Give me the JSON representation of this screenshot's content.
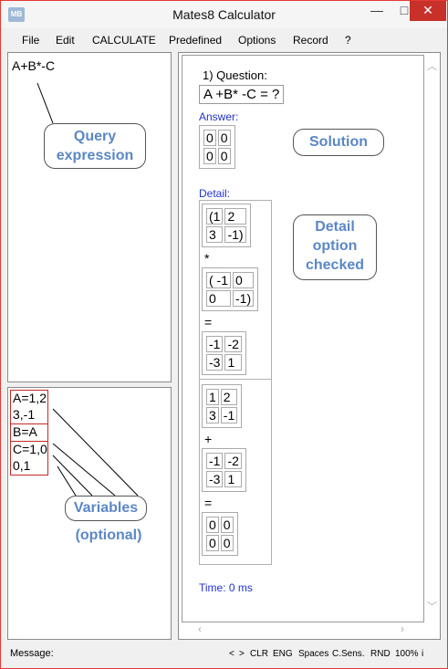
{
  "window": {
    "title": "Mates8 Calculator",
    "icon_text": "MB",
    "minimize": "—",
    "maximize": "□",
    "close": "✕"
  },
  "menu": [
    "File",
    "Edit",
    "CALCULATE",
    "Predefined",
    "Options",
    "Record",
    "?"
  ],
  "query": {
    "text": "A+B*-C"
  },
  "variables": {
    "lines": [
      "A=1,2",
      "3,-1",
      "B=A",
      "C=1,0",
      "0,1"
    ]
  },
  "callouts": {
    "query": [
      "Query",
      "expression"
    ],
    "variables": [
      "Variables",
      "(optional)"
    ],
    "solution": "Solution",
    "detail": [
      "Detail",
      "option",
      "checked"
    ]
  },
  "result": {
    "question_label": "1) Question:",
    "question": "A +B* -C = ?",
    "answer_label": "Answer:",
    "answer": [
      [
        "0",
        "0"
      ],
      [
        "0",
        "0"
      ]
    ],
    "detail_label": "Detail:",
    "step1": {
      "m1": [
        [
          "(1",
          "2"
        ],
        [
          "3",
          "-1)"
        ]
      ],
      "op": "*",
      "m2": [
        [
          "( -1",
          "0"
        ],
        [
          "0",
          "-1)"
        ]
      ],
      "eq": "=",
      "m3": [
        [
          "-1",
          "-2"
        ],
        [
          "-3",
          "1"
        ]
      ]
    },
    "step2": {
      "m1": [
        [
          "1",
          "2"
        ],
        [
          "3",
          "-1"
        ]
      ],
      "op": "+",
      "m2": [
        [
          "-1",
          "-2"
        ],
        [
          "-3",
          "1"
        ]
      ],
      "eq": "=",
      "m3": [
        [
          "0",
          "0"
        ],
        [
          "0",
          "0"
        ]
      ]
    },
    "time": "Time: 0 ms"
  },
  "status": {
    "message_label": "Message:",
    "items": [
      "<",
      ">",
      "CLR",
      "ENG",
      "Spaces",
      "C.Sens.",
      "RND",
      "100%",
      "i"
    ]
  }
}
